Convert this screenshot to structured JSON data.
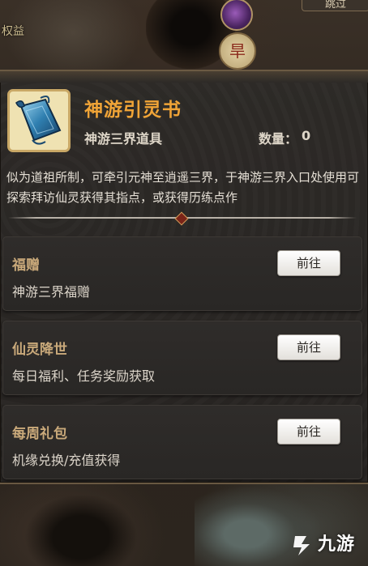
{
  "background": {
    "top_left_text": "权益",
    "top_right_button": "跳过",
    "seal_char": "旱"
  },
  "item": {
    "name": "神游引灵书",
    "type": "神游三界道具",
    "quantity_label": "数量：",
    "quantity_value": "0",
    "description": "似为道祖所制，可牵引元神至逍遥三界，于神游三界入口处使用可探索拜访仙灵获得其指点，或获得历练点作",
    "icon": "scroll-icon"
  },
  "sources": [
    {
      "title": "福赠",
      "desc": "神游三界福赠",
      "button": "前往"
    },
    {
      "title": "仙灵降世",
      "desc": "每日福利、任务奖励获取",
      "button": "前往"
    },
    {
      "title": "每周礼包",
      "desc": "机缘兑换/充值获得",
      "button": "前往"
    }
  ],
  "watermark": {
    "text": "九游"
  },
  "colors": {
    "item_name": "#f0a437",
    "source_title": "#c9a97a",
    "panel_bg": "#2d2a27",
    "panel_border": "#6b5a43"
  }
}
